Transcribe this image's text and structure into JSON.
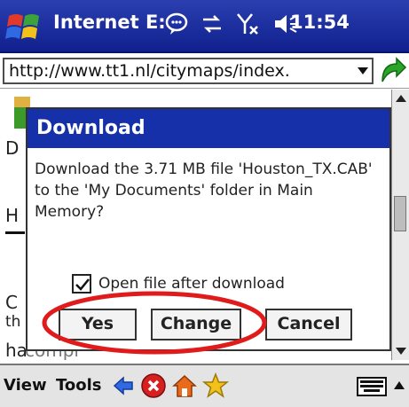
{
  "titlebar": {
    "app_title": "Internet E:",
    "clock": "11:54",
    "icons": [
      "windows-start-icon",
      "chat-bubble-icon",
      "connectivity-icon",
      "signal-icon",
      "volume-icon"
    ]
  },
  "address": {
    "url": "http://www.tt1.nl/citymaps/index.",
    "go_icon": "go-arrow-icon"
  },
  "page": {
    "glimpses": [
      "D",
      "H",
      "C",
      "th",
      "ha",
      "compl"
    ]
  },
  "dialog": {
    "title": "Download",
    "message": "Download the 3.71 MB file 'Houston_TX.CAB' to the 'My Documents' folder in Main Memory?",
    "checkbox_label": "Open file after download",
    "checkbox_checked": true,
    "buttons": {
      "yes": "Yes",
      "change": "Change",
      "cancel": "Cancel"
    }
  },
  "menubar": {
    "view": "View",
    "tools": "Tools",
    "icons": [
      "back-icon",
      "stop-icon",
      "home-icon",
      "favorites-icon",
      "keyboard-icon"
    ]
  },
  "colors": {
    "titlebar": "#1530a8",
    "highlight": "#e01b1b",
    "stop": "#d62020",
    "home": "#e86a1a",
    "favorites": "#f2c21b"
  }
}
